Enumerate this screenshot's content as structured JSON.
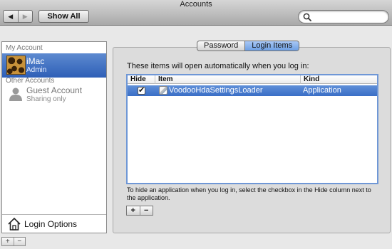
{
  "window": {
    "title": "Accounts"
  },
  "toolbar": {
    "back_glyph": "◀",
    "forward_glyph": "▶",
    "show_all_label": "Show All",
    "search_value": "",
    "search_placeholder": ""
  },
  "sidebar": {
    "my_account_header": "My Account",
    "selected_account": {
      "name": "iMac",
      "role": "Admin"
    },
    "other_accounts_header": "Other Accounts",
    "guest_account": {
      "name": "Guest Account",
      "role": "Sharing only"
    },
    "login_options_label": "Login Options",
    "add_label": "+",
    "remove_label": "−"
  },
  "tabs": [
    {
      "label": "Password",
      "active": false
    },
    {
      "label": "Login Items",
      "active": true
    }
  ],
  "login_items": {
    "instructions": "These items will open automatically when you log in:",
    "columns": {
      "hide": "Hide",
      "item": "Item",
      "kind": "Kind"
    },
    "rows": [
      {
        "hide_checked": true,
        "item": "VoodooHdaSettingsLoader",
        "kind": "Application",
        "icon": "app-icon"
      }
    ],
    "hint": "To hide an application when you log in, select the checkbox in the Hide column next to the application.",
    "add_label": "+",
    "remove_label": "−"
  },
  "colors": {
    "selection": "#3a6ec6",
    "active_tab": "#8db5ee"
  }
}
